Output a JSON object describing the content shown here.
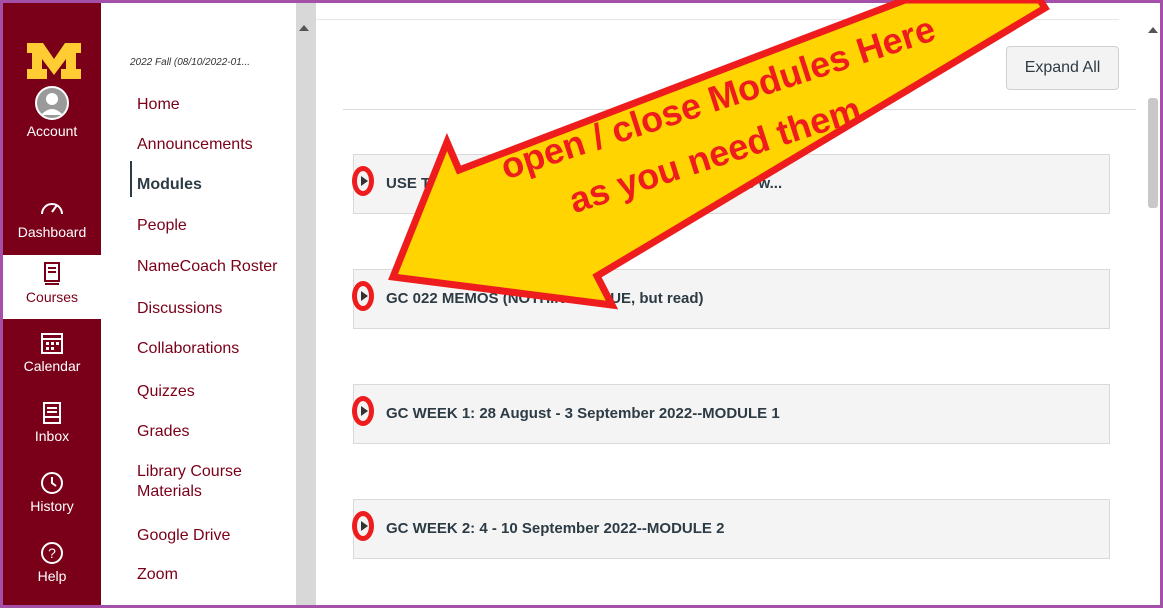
{
  "global_nav": {
    "brand_color": "#7a0019",
    "items": [
      {
        "label": "Account",
        "icon": "account-avatar-icon"
      },
      {
        "label": "Dashboard",
        "icon": "dashboard-gauge-icon"
      },
      {
        "label": "Courses",
        "icon": "courses-book-icon",
        "active": true
      },
      {
        "label": "Calendar",
        "icon": "calendar-icon"
      },
      {
        "label": "Inbox",
        "icon": "inbox-icon"
      },
      {
        "label": "History",
        "icon": "history-clock-icon"
      },
      {
        "label": "Help",
        "icon": "help-question-icon"
      }
    ]
  },
  "course_nav": {
    "term": "2022 Fall (08/10/2022-01...",
    "links": [
      {
        "label": "Home"
      },
      {
        "label": "Announcements"
      },
      {
        "label": "Modules",
        "active": true
      },
      {
        "label": "People"
      },
      {
        "label": "NameCoach Roster"
      },
      {
        "label": "Discussions"
      },
      {
        "label": "Collaborations"
      },
      {
        "label": "Quizzes"
      },
      {
        "label": "Grades"
      },
      {
        "label": "Library Course Materials"
      },
      {
        "label": "Google Drive"
      },
      {
        "label": "Zoom"
      }
    ]
  },
  "main": {
    "expand_all_label": "Expand All",
    "modules": [
      {
        "title": "USE TH    COLL                          ABOVE (If you do not, the first weeks w..."
      },
      {
        "title": "GC               022 MEMOS (NOTHING IS DUE, but read)"
      },
      {
        "title": "GC WEEK 1: 28 August - 3 September 2022--MODULE 1"
      },
      {
        "title": "GC WEEK 2: 4 - 10 September 2022--MODULE 2"
      }
    ]
  },
  "annotation": {
    "line1": "open / close Modules Here",
    "line2": "as you need them",
    "arrow_color": "#ffd400",
    "outline_color": "#ee1c1c"
  }
}
